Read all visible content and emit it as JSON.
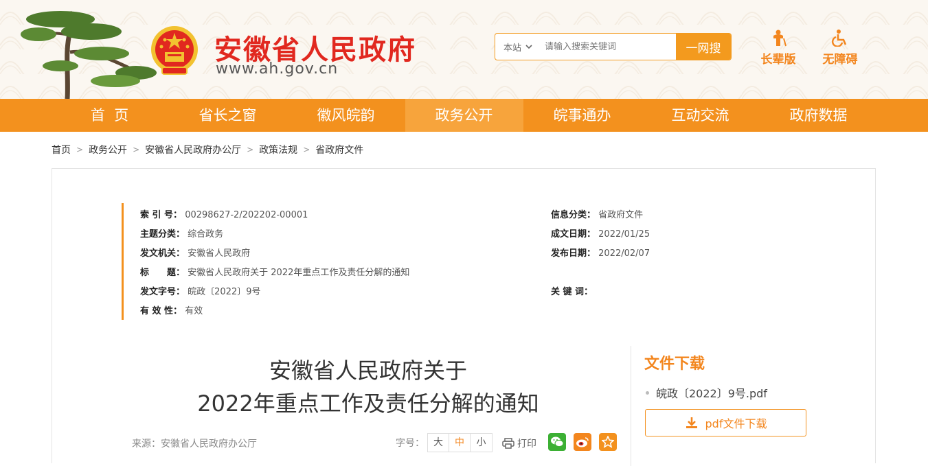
{
  "header": {
    "site_title": "安徽省人民政府",
    "site_url": "www.ah.gov.cn",
    "search": {
      "scope": "本站",
      "placeholder": "请输入搜索关键词",
      "button": "一网搜"
    },
    "tools": [
      {
        "label": "长辈版",
        "icon": "elder-icon"
      },
      {
        "label": "无障碍",
        "icon": "wheelchair-icon"
      }
    ]
  },
  "nav": {
    "items": [
      "首  页",
      "省长之窗",
      "徽风皖韵",
      "政务公开",
      "皖事通办",
      "互动交流",
      "政府数据"
    ],
    "active": "政务公开"
  },
  "breadcrumb": [
    "首页",
    "政务公开",
    "安徽省人民政府办公厅",
    "政策法规",
    "省政府文件"
  ],
  "meta": {
    "index_label": "索 引 号：",
    "index_value": "00298627-2/202202-00001",
    "category_label": "信息分类：",
    "category_value": "省政府文件",
    "topic_label": "主题分类：",
    "topic_value": "综合政务",
    "created_label": "成文日期：",
    "created_value": "2022/01/25",
    "issuer_label": "发文机关：",
    "issuer_value": "安徽省人民政府",
    "published_label": "发布日期：",
    "published_value": "2022/02/07",
    "title_label": "标　　题：",
    "title_value": "安徽省人民政府关于 2022年重点工作及责任分解的通知",
    "docno_label": "发文字号：",
    "docno_value": "皖政〔2022〕9号",
    "keywords_label": "关 键 词：",
    "keywords_value": "",
    "validity_label": "有 效 性：",
    "validity_value": "有效"
  },
  "document": {
    "title_line1": "安徽省人民政府关于",
    "title_line2": "2022年重点工作及责任分解的通知",
    "source": "来源：安徽省人民政府办公厅",
    "fontsize_label": "字号：",
    "fontsize_options": [
      "大",
      "中",
      "小"
    ],
    "fontsize_active": "中",
    "print_label": "打印"
  },
  "download": {
    "title": "文件下载",
    "file_name": "皖政〔2022〕9号.pdf",
    "button": "pdf文件下载"
  },
  "colors": {
    "brand_orange": "#f3911e",
    "title_red": "#e1281f",
    "wechat_green": "#3cb034",
    "weibo_orange": "#f3861e",
    "star_orange": "#f3911e"
  }
}
